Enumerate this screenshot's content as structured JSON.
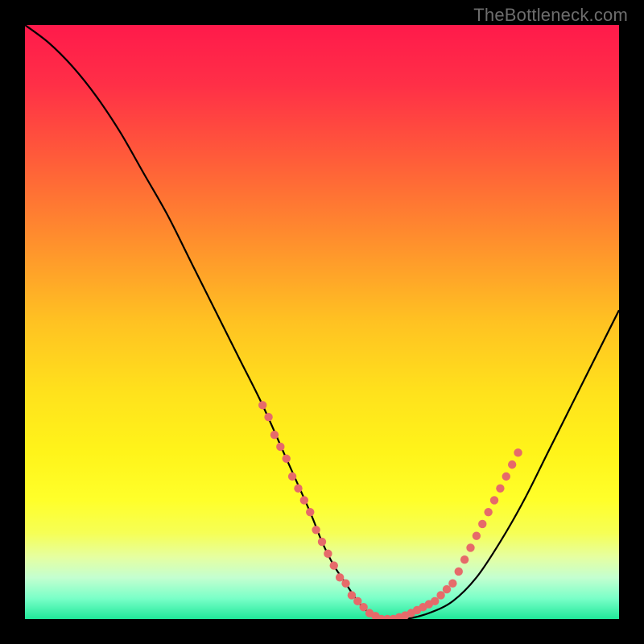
{
  "watermark": "TheBottleneck.com",
  "colors": {
    "frame_border": "#000000",
    "gradient_stops": [
      {
        "offset": 0.0,
        "color": "#ff1a4b"
      },
      {
        "offset": 0.1,
        "color": "#ff2f47"
      },
      {
        "offset": 0.22,
        "color": "#ff5a3a"
      },
      {
        "offset": 0.35,
        "color": "#ff8a2e"
      },
      {
        "offset": 0.5,
        "color": "#ffc222"
      },
      {
        "offset": 0.62,
        "color": "#ffe21c"
      },
      {
        "offset": 0.72,
        "color": "#fff41a"
      },
      {
        "offset": 0.8,
        "color": "#ffff2a"
      },
      {
        "offset": 0.855,
        "color": "#f6ff55"
      },
      {
        "offset": 0.895,
        "color": "#e6ffa0"
      },
      {
        "offset": 0.93,
        "color": "#c4ffd0"
      },
      {
        "offset": 0.965,
        "color": "#7affc8"
      },
      {
        "offset": 1.0,
        "color": "#20e89a"
      }
    ],
    "curve": "#000000",
    "dot": "#e66a6a"
  },
  "chart_data": {
    "type": "line",
    "title": "",
    "xlabel": "",
    "ylabel": "",
    "xlim": [
      0,
      100
    ],
    "ylim": [
      0,
      100
    ],
    "series": [
      {
        "name": "bottleneck-curve",
        "x": [
          0,
          4,
          8,
          12,
          16,
          20,
          24,
          28,
          32,
          36,
          40,
          44,
          48,
          50,
          52,
          54,
          56,
          58,
          60,
          64,
          68,
          72,
          76,
          80,
          84,
          88,
          92,
          96,
          100
        ],
        "y": [
          100,
          97,
          93,
          88,
          82,
          75,
          68,
          60,
          52,
          44,
          36,
          27,
          18,
          13,
          9,
          6,
          3,
          1,
          0,
          0,
          1,
          3,
          7,
          13,
          20,
          28,
          36,
          44,
          52
        ]
      }
    ],
    "highlight_dots": {
      "name": "pink-dots",
      "points": [
        {
          "x": 40,
          "y": 36
        },
        {
          "x": 41,
          "y": 34
        },
        {
          "x": 42,
          "y": 31
        },
        {
          "x": 43,
          "y": 29
        },
        {
          "x": 44,
          "y": 27
        },
        {
          "x": 45,
          "y": 24
        },
        {
          "x": 46,
          "y": 22
        },
        {
          "x": 47,
          "y": 20
        },
        {
          "x": 48,
          "y": 18
        },
        {
          "x": 49,
          "y": 15
        },
        {
          "x": 50,
          "y": 13
        },
        {
          "x": 51,
          "y": 11
        },
        {
          "x": 52,
          "y": 9
        },
        {
          "x": 53,
          "y": 7
        },
        {
          "x": 54,
          "y": 6
        },
        {
          "x": 55,
          "y": 4
        },
        {
          "x": 56,
          "y": 3
        },
        {
          "x": 57,
          "y": 2
        },
        {
          "x": 58,
          "y": 1
        },
        {
          "x": 59,
          "y": 0.5
        },
        {
          "x": 60,
          "y": 0
        },
        {
          "x": 61,
          "y": 0
        },
        {
          "x": 62,
          "y": 0
        },
        {
          "x": 63,
          "y": 0.3
        },
        {
          "x": 64,
          "y": 0.6
        },
        {
          "x": 65,
          "y": 1
        },
        {
          "x": 66,
          "y": 1.5
        },
        {
          "x": 67,
          "y": 2
        },
        {
          "x": 68,
          "y": 2.5
        },
        {
          "x": 69,
          "y": 3
        },
        {
          "x": 70,
          "y": 4
        },
        {
          "x": 71,
          "y": 5
        },
        {
          "x": 72,
          "y": 6
        },
        {
          "x": 73,
          "y": 8
        },
        {
          "x": 74,
          "y": 10
        },
        {
          "x": 75,
          "y": 12
        },
        {
          "x": 76,
          "y": 14
        },
        {
          "x": 77,
          "y": 16
        },
        {
          "x": 78,
          "y": 18
        },
        {
          "x": 79,
          "y": 20
        },
        {
          "x": 80,
          "y": 22
        },
        {
          "x": 81,
          "y": 24
        },
        {
          "x": 82,
          "y": 26
        },
        {
          "x": 83,
          "y": 28
        }
      ]
    }
  }
}
